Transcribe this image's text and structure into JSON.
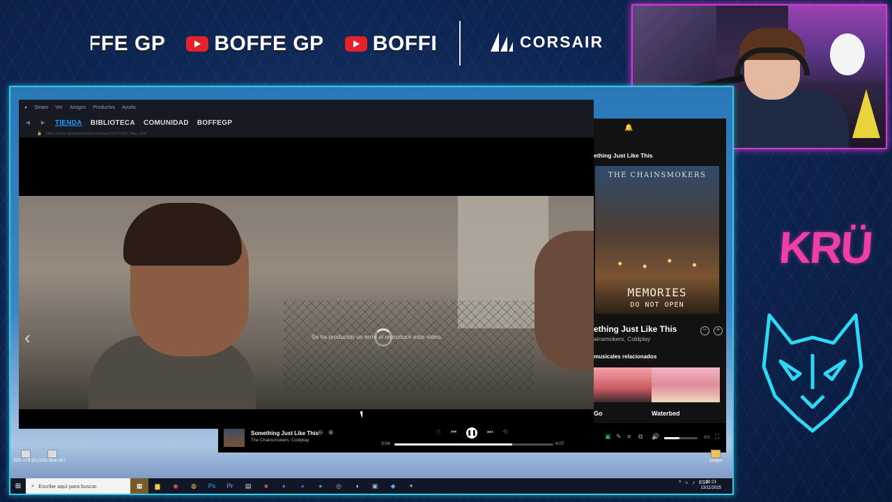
{
  "banner": {
    "ticker_items": [
      "BOFFE GP",
      "BOFFE GP",
      "BOFFE F"
    ],
    "sponsor": "CORSAIR"
  },
  "overlay": {
    "team_logo": "KRÜ",
    "wolf_icon": "wolf-logo-icon"
  },
  "steam": {
    "menu": [
      "Steam",
      "Ver",
      "Amigos",
      "Productos",
      "Ayuda"
    ],
    "nav": [
      "TIENDA",
      "BIBLIOTECA",
      "COMUNIDAD",
      "BOFFEGP"
    ],
    "active_tab": "TIENDA",
    "url": "https://store.steampowered.com/app/1222700/A_Way_Out/",
    "video_error": "Se ha producido un error al reproducir este vídeo."
  },
  "spotify": {
    "now_playing_header": "ething Just Like This",
    "album_band": "THE CHAINSMOKERS",
    "album_title_1": "MEMORIES",
    "album_title_2": "DO NOT OPEN",
    "song": "ething Just Like This",
    "artists": "ainsmokers, Coldplay",
    "related_header": "musicales relacionados",
    "related": [
      "Go",
      "Waterbed"
    ],
    "player": {
      "song": "Something Just Like This",
      "artists": "The Chainsmokers, Coldplay",
      "elapsed": "3:04",
      "duration": "4:07",
      "progress": 0.74,
      "volume": 0.45
    }
  },
  "desktop": {
    "drives": [
      "SSD 1TB (D:)",
      "SSD Blue (G:)"
    ],
    "game_icon_label": "Juegos"
  },
  "taskbar": {
    "search_placeholder": "Escribe aquí para buscar.",
    "language": "ESP",
    "time": "02:23",
    "date": "13/11/2025"
  },
  "colors": {
    "overlay_border": "#35c8e8",
    "webcam_border": "#d63ad6",
    "kru_pink": "#ee3ea7",
    "steam_active": "#1a9fff",
    "youtube_red": "#e7212b"
  }
}
